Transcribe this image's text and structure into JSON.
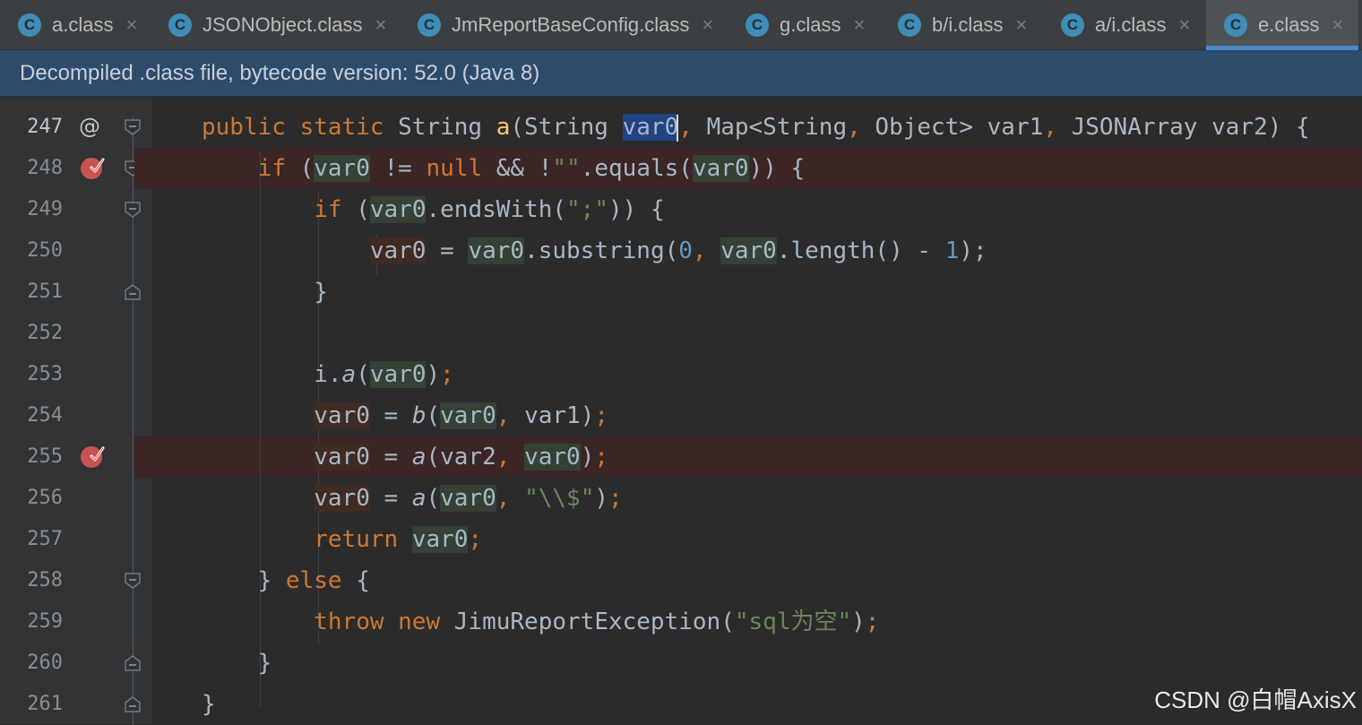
{
  "tabs": [
    {
      "icon": "C",
      "label": "a.class",
      "active": false
    },
    {
      "icon": "C",
      "label": "JSONObject.class",
      "active": false
    },
    {
      "icon": "C",
      "label": "JmReportBaseConfig.class",
      "active": false
    },
    {
      "icon": "C",
      "label": "g.class",
      "active": false
    },
    {
      "icon": "C",
      "label": "b/i.class",
      "active": false
    },
    {
      "icon": "C",
      "label": "a/i.class",
      "active": false
    },
    {
      "icon": "C",
      "label": "e.class",
      "active": true
    }
  ],
  "close_glyph": "×",
  "banner": "Decompiled .class file, bytecode version: 52.0 (Java 8)",
  "lines": [
    {
      "num": "247",
      "marker": "@",
      "breakpoint": false,
      "fold": "start"
    },
    {
      "num": "248",
      "breakpoint": true,
      "fold": "start"
    },
    {
      "num": "249",
      "breakpoint": false,
      "fold": "start"
    },
    {
      "num": "250",
      "breakpoint": false
    },
    {
      "num": "251",
      "breakpoint": false,
      "fold": "end"
    },
    {
      "num": "252",
      "breakpoint": false
    },
    {
      "num": "253",
      "breakpoint": false
    },
    {
      "num": "254",
      "breakpoint": false
    },
    {
      "num": "255",
      "breakpoint": true
    },
    {
      "num": "256",
      "breakpoint": false
    },
    {
      "num": "257",
      "breakpoint": false
    },
    {
      "num": "258",
      "breakpoint": false,
      "fold": "start"
    },
    {
      "num": "259",
      "breakpoint": false
    },
    {
      "num": "260",
      "breakpoint": false,
      "fold": "end"
    },
    {
      "num": "261",
      "breakpoint": false,
      "fold": "end"
    }
  ],
  "code": [
    [
      {
        "t": "public static ",
        "c": "kw"
      },
      {
        "t": "String "
      },
      {
        "t": "a",
        "c": "fn"
      },
      {
        "t": "(String "
      },
      {
        "t": "var0",
        "c": "sel",
        "caret": true
      },
      {
        "t": ", ",
        "c": "kw"
      },
      {
        "t": "Map<String"
      },
      {
        "t": ", ",
        "c": "kw"
      },
      {
        "t": "Object> var1"
      },
      {
        "t": ", ",
        "c": "kw"
      },
      {
        "t": "JSONArray var2) {"
      }
    ],
    [
      {
        "t": "    "
      },
      {
        "t": "if ",
        "c": "kw"
      },
      {
        "t": "("
      },
      {
        "t": "var0",
        "c": "hl"
      },
      {
        "t": " != "
      },
      {
        "t": "null ",
        "c": "kw"
      },
      {
        "t": "&& !"
      },
      {
        "t": "\"\"",
        "c": "str"
      },
      {
        "t": ".equals("
      },
      {
        "t": "var0",
        "c": "hl"
      },
      {
        "t": ")) {"
      }
    ],
    [
      {
        "t": "        "
      },
      {
        "t": "if ",
        "c": "kw"
      },
      {
        "t": "("
      },
      {
        "t": "var0",
        "c": "hl"
      },
      {
        "t": ".endsWith("
      },
      {
        "t": "\";\"",
        "c": "str"
      },
      {
        "t": ")) {"
      }
    ],
    [
      {
        "t": "            "
      },
      {
        "t": "var0",
        "c": "hw"
      },
      {
        "t": " = "
      },
      {
        "t": "var0",
        "c": "hl"
      },
      {
        "t": ".substring("
      },
      {
        "t": "0",
        "c": "num"
      },
      {
        "t": ", ",
        "c": "kw"
      },
      {
        "t": "var0",
        "c": "hl"
      },
      {
        "t": ".length() - "
      },
      {
        "t": "1",
        "c": "num"
      },
      {
        "t": ");"
      }
    ],
    [
      {
        "t": "        }"
      }
    ],
    [
      {
        "t": ""
      }
    ],
    [
      {
        "t": "        i."
      },
      {
        "t": "a",
        "c": "it"
      },
      {
        "t": "("
      },
      {
        "t": "var0",
        "c": "hl"
      },
      {
        "t": ")"
      },
      {
        "t": ";",
        "c": "kw"
      }
    ],
    [
      {
        "t": "        "
      },
      {
        "t": "var0",
        "c": "hw"
      },
      {
        "t": " = "
      },
      {
        "t": "b",
        "c": "it"
      },
      {
        "t": "("
      },
      {
        "t": "var0",
        "c": "hl"
      },
      {
        "t": ", ",
        "c": "kw"
      },
      {
        "t": "var1)"
      },
      {
        "t": ";",
        "c": "kw"
      }
    ],
    [
      {
        "t": "        "
      },
      {
        "t": "var0",
        "c": "hw"
      },
      {
        "t": " = "
      },
      {
        "t": "a",
        "c": "it"
      },
      {
        "t": "(var2"
      },
      {
        "t": ", ",
        "c": "kw"
      },
      {
        "t": "var0",
        "c": "hl"
      },
      {
        "t": ")"
      },
      {
        "t": ";",
        "c": "kw"
      }
    ],
    [
      {
        "t": "        "
      },
      {
        "t": "var0",
        "c": "hw"
      },
      {
        "t": " = "
      },
      {
        "t": "a",
        "c": "it"
      },
      {
        "t": "("
      },
      {
        "t": "var0",
        "c": "hl"
      },
      {
        "t": ", ",
        "c": "kw"
      },
      {
        "t": "\"\\\\$\"",
        "c": "str"
      },
      {
        "t": ")"
      },
      {
        "t": ";",
        "c": "kw"
      }
    ],
    [
      {
        "t": "        "
      },
      {
        "t": "return ",
        "c": "kw"
      },
      {
        "t": "var0",
        "c": "hl"
      },
      {
        "t": ";",
        "c": "kw"
      }
    ],
    [
      {
        "t": "    } "
      },
      {
        "t": "else ",
        "c": "kw"
      },
      {
        "t": "{"
      }
    ],
    [
      {
        "t": "        "
      },
      {
        "t": "throw new ",
        "c": "kw"
      },
      {
        "t": "JimuReportException("
      },
      {
        "t": "\"sql为空\"",
        "c": "str"
      },
      {
        "t": ")"
      },
      {
        "t": ";",
        "c": "kw"
      }
    ],
    [
      {
        "t": "    }"
      }
    ],
    [
      {
        "t": "}"
      }
    ]
  ],
  "watermark": "CSDN @白帽AxisX"
}
